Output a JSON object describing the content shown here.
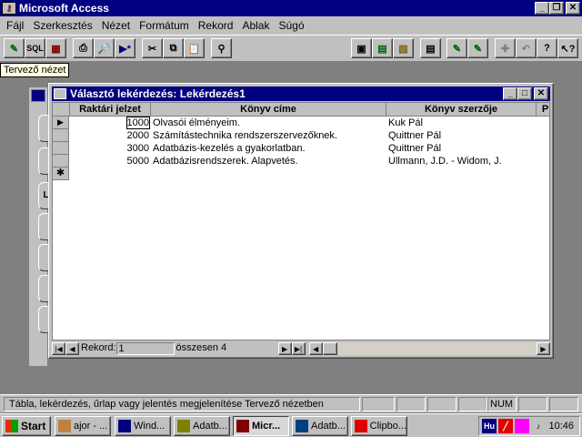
{
  "app": {
    "title": "Microsoft Access"
  },
  "menu": [
    {
      "label": "Fájl"
    },
    {
      "label": "Szerkesztés"
    },
    {
      "label": "Nézet"
    },
    {
      "label": "Formátum"
    },
    {
      "label": "Rekord"
    },
    {
      "label": "Ablak"
    },
    {
      "label": "Súgó"
    }
  ],
  "toolbar": {
    "sql_label": "SQL",
    "buttons": [
      "design-view",
      "sql-view",
      "datasheet-view",
      "print",
      "print-preview",
      "new-record",
      "cut",
      "copy",
      "paste",
      "find",
      "new-object",
      "properties",
      "database-window",
      "build",
      "new-query",
      "filter-by-form",
      "undo",
      "help",
      "context-help"
    ]
  },
  "tooltip": "Tervező nézet",
  "query_window": {
    "title": "Választó lekérdezés: Lekérdezés1",
    "columns": [
      "Raktári jelzet",
      "Könyv címe",
      "Könyv szerzője",
      "P"
    ],
    "rows": [
      {
        "id": "1000",
        "title": "Olvasói élményeim.",
        "author": "Kuk Pál"
      },
      {
        "id": "2000",
        "title": "Számítástechnika rendszerszervezőknek.",
        "author": "Quittner Pál"
      },
      {
        "id": "3000",
        "title": "Adatbázis-kezelés a gyakorlatban.",
        "author": "Quittner Pál"
      },
      {
        "id": "5000",
        "title": "Adatbázisrendszerek. Alapvetés.",
        "author": "Ullmann, J.D. - Widom, J."
      }
    ],
    "nav": {
      "record_label": "Rekord:",
      "record_value": "1",
      "total": "összesen  4"
    }
  },
  "back_window": {
    "tab_letter": "L"
  },
  "status": {
    "text": "Tábla, lekérdezés, űrlap vagy jelentés megjelenítése Tervező nézetben",
    "num": "NUM"
  },
  "taskbar": {
    "start": "Start",
    "tasks": [
      "ajor - ...",
      "Wind...",
      "Adatb...",
      "Micr...",
      "Adatb...",
      "Clipbo..."
    ],
    "tray_lang": "Hu",
    "clock": "10:46"
  },
  "colors": {
    "titlebar": "#000080",
    "face": "#c0c0c0",
    "desktop": "#808080",
    "tooltip": "#ffffe1"
  }
}
